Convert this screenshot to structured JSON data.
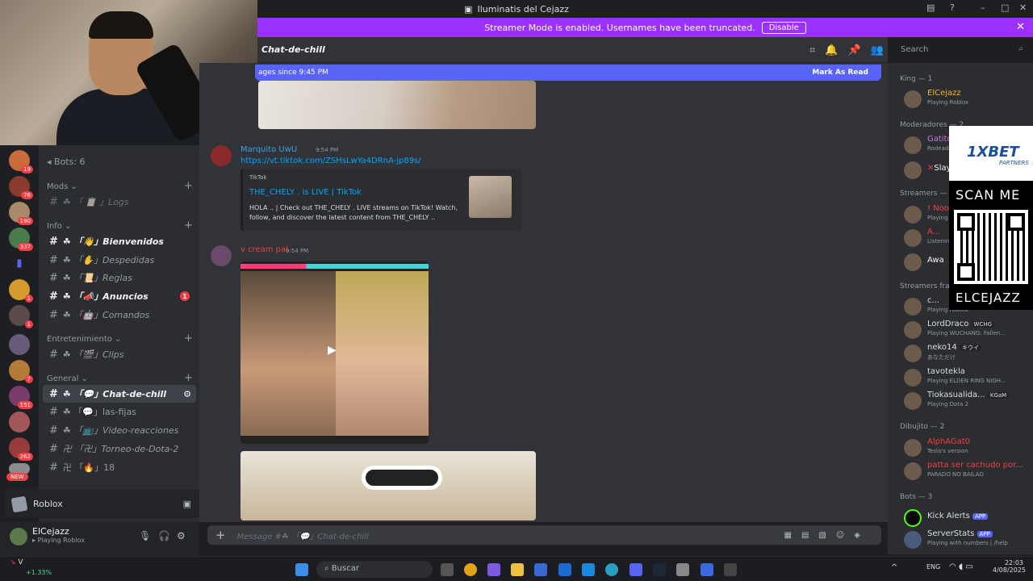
{
  "window": {
    "title": "Iluminatis del Cejazz"
  },
  "streamer_bar": {
    "message": "Streamer Mode is enabled. Usernames have been truncated.",
    "disable_label": "Disable"
  },
  "server_badges": [
    "19",
    "76",
    "190",
    "337",
    "",
    "1",
    "1",
    "",
    "7",
    "151",
    "",
    "262",
    ""
  ],
  "new_label": "NEW",
  "sidebar": {
    "bots_label": "Bots: 6",
    "categories": {
      "mods": "Mods",
      "info": "Info",
      "entretenimiento": "Entretenimiento",
      "general": "General"
    },
    "channels": {
      "logs": "☘ 「 📋 」Logs",
      "bienvenidos": "☘ 「👋」Bienvenidos",
      "despedidas": "☘ 「✋」Despedidas",
      "reglas": "☘ 「📜」Reglas",
      "anuncios": "☘ 「📣」Anuncios",
      "comandos": "☘ 「🤖」Comandos",
      "clips": "☘ 「🎬」Clips",
      "chat": "☘ 「💬」Chat-de-chill",
      "fijas": "☘ 「💬」las-fijas",
      "video": "☘ 「📺」Video-reacciones",
      "torneo": "卍 「卍」Torneo-de-Dota-2",
      "n18": "卍 「🔥」18"
    },
    "anuncios_badge": "1"
  },
  "voice": {
    "label": "Roblox"
  },
  "user": {
    "name": "ElCejazz",
    "status": "Playing Roblox"
  },
  "header": {
    "channel": "Chat-de-chill",
    "search_placeholder": "Search"
  },
  "new_messages": {
    "text": "ages since 9:45 PM",
    "mark_read": "Mark As Read"
  },
  "messages": [
    {
      "author": "Marquito UwU",
      "time": "9:54 PM",
      "link": "https://vt.tiktok.com/ZSHsLwYa4DRnA-jp89s/",
      "embed": {
        "provider": "TikTok",
        "title": "THE_CHELY . is LIVE | TikTok",
        "description": "HOLA .. | Check out THE_CHELY . LIVE streams on TikTok! Watch, follow, and discover the latest content from THE_CHELY .."
      }
    },
    {
      "author": "v cream pal",
      "time": "9:54 PM"
    }
  ],
  "composer": {
    "placeholder": "Message #☘ 「💬」Chat-de-chill"
  },
  "members": {
    "groups": [
      {
        "title": "King — 1",
        "members": [
          {
            "name": "ElCejazz",
            "status": "Playing Roblox",
            "color": "#f0b232"
          }
        ]
      },
      {
        "title": "Moderadores — 2",
        "members": [
          {
            "name": "Gatito Fe",
            "status": "Rodeado de",
            "color": "#c678dd"
          },
          {
            "name": "Slayer",
            "status": "",
            "color": "#f2f3f5"
          }
        ]
      },
      {
        "title": "Streamers — 3",
        "members": [
          {
            "name": "! Noo",
            "status": "Playing",
            "color": "#f23f43"
          },
          {
            "name": "A...",
            "status": "Listening",
            "color": "#f23f43"
          },
          {
            "name": "Awa",
            "status": "",
            "color": "#f2f3f5"
          }
        ]
      },
      {
        "title": "Streamers frac",
        "members": [
          {
            "name": "c...",
            "status": "Playing Roblox",
            "color": "#dbdee1"
          },
          {
            "name": "LordDraco",
            "status": "Playing WUCHANG: Fallen...",
            "color": "#dbdee1",
            "tag": "WCHG"
          },
          {
            "name": "neko14",
            "status": "あなただけ",
            "color": "#dbdee1",
            "tag": "キウイ"
          },
          {
            "name": "tavotekla",
            "status": "Playing ELDEN RING NIGH...",
            "color": "#dbdee1"
          },
          {
            "name": "Tiokasualida...",
            "status": "Playing Dota 2",
            "color": "#dbdee1",
            "tag": "KGaM"
          }
        ]
      },
      {
        "title": "Dibujito — 2",
        "members": [
          {
            "name": "AlphAGat0",
            "status": "Tesla's version",
            "color": "#f23f43"
          },
          {
            "name": "patta ser cachudo por...",
            "status": "PARADO NO BAILAO",
            "color": "#f23f43"
          }
        ]
      },
      {
        "title": "Bots — 3",
        "members": [
          {
            "name": "Kick Alerts",
            "status": "",
            "color": "#f2f3f5",
            "tag": "APP"
          },
          {
            "name": "ServerStats",
            "status": "Playing with numbers | /help",
            "color": "#dbdee1",
            "tag": "APP"
          }
        ]
      }
    ]
  },
  "ad": {
    "brand": "1XBET",
    "sub": "PARTNERS",
    "scan": "SCAN ME",
    "code": "ELCEJAZZ"
  },
  "taskbar": {
    "search": "Buscar",
    "lang": "ENG",
    "time": "22:03",
    "date": "4/08/2025",
    "ticker": "V",
    "ticker_change": "+1.33%"
  },
  "colors": {
    "accent": "#5865f2",
    "streamer": "#9b30ff",
    "link": "#00a8fc",
    "unread": "#f23f43"
  }
}
